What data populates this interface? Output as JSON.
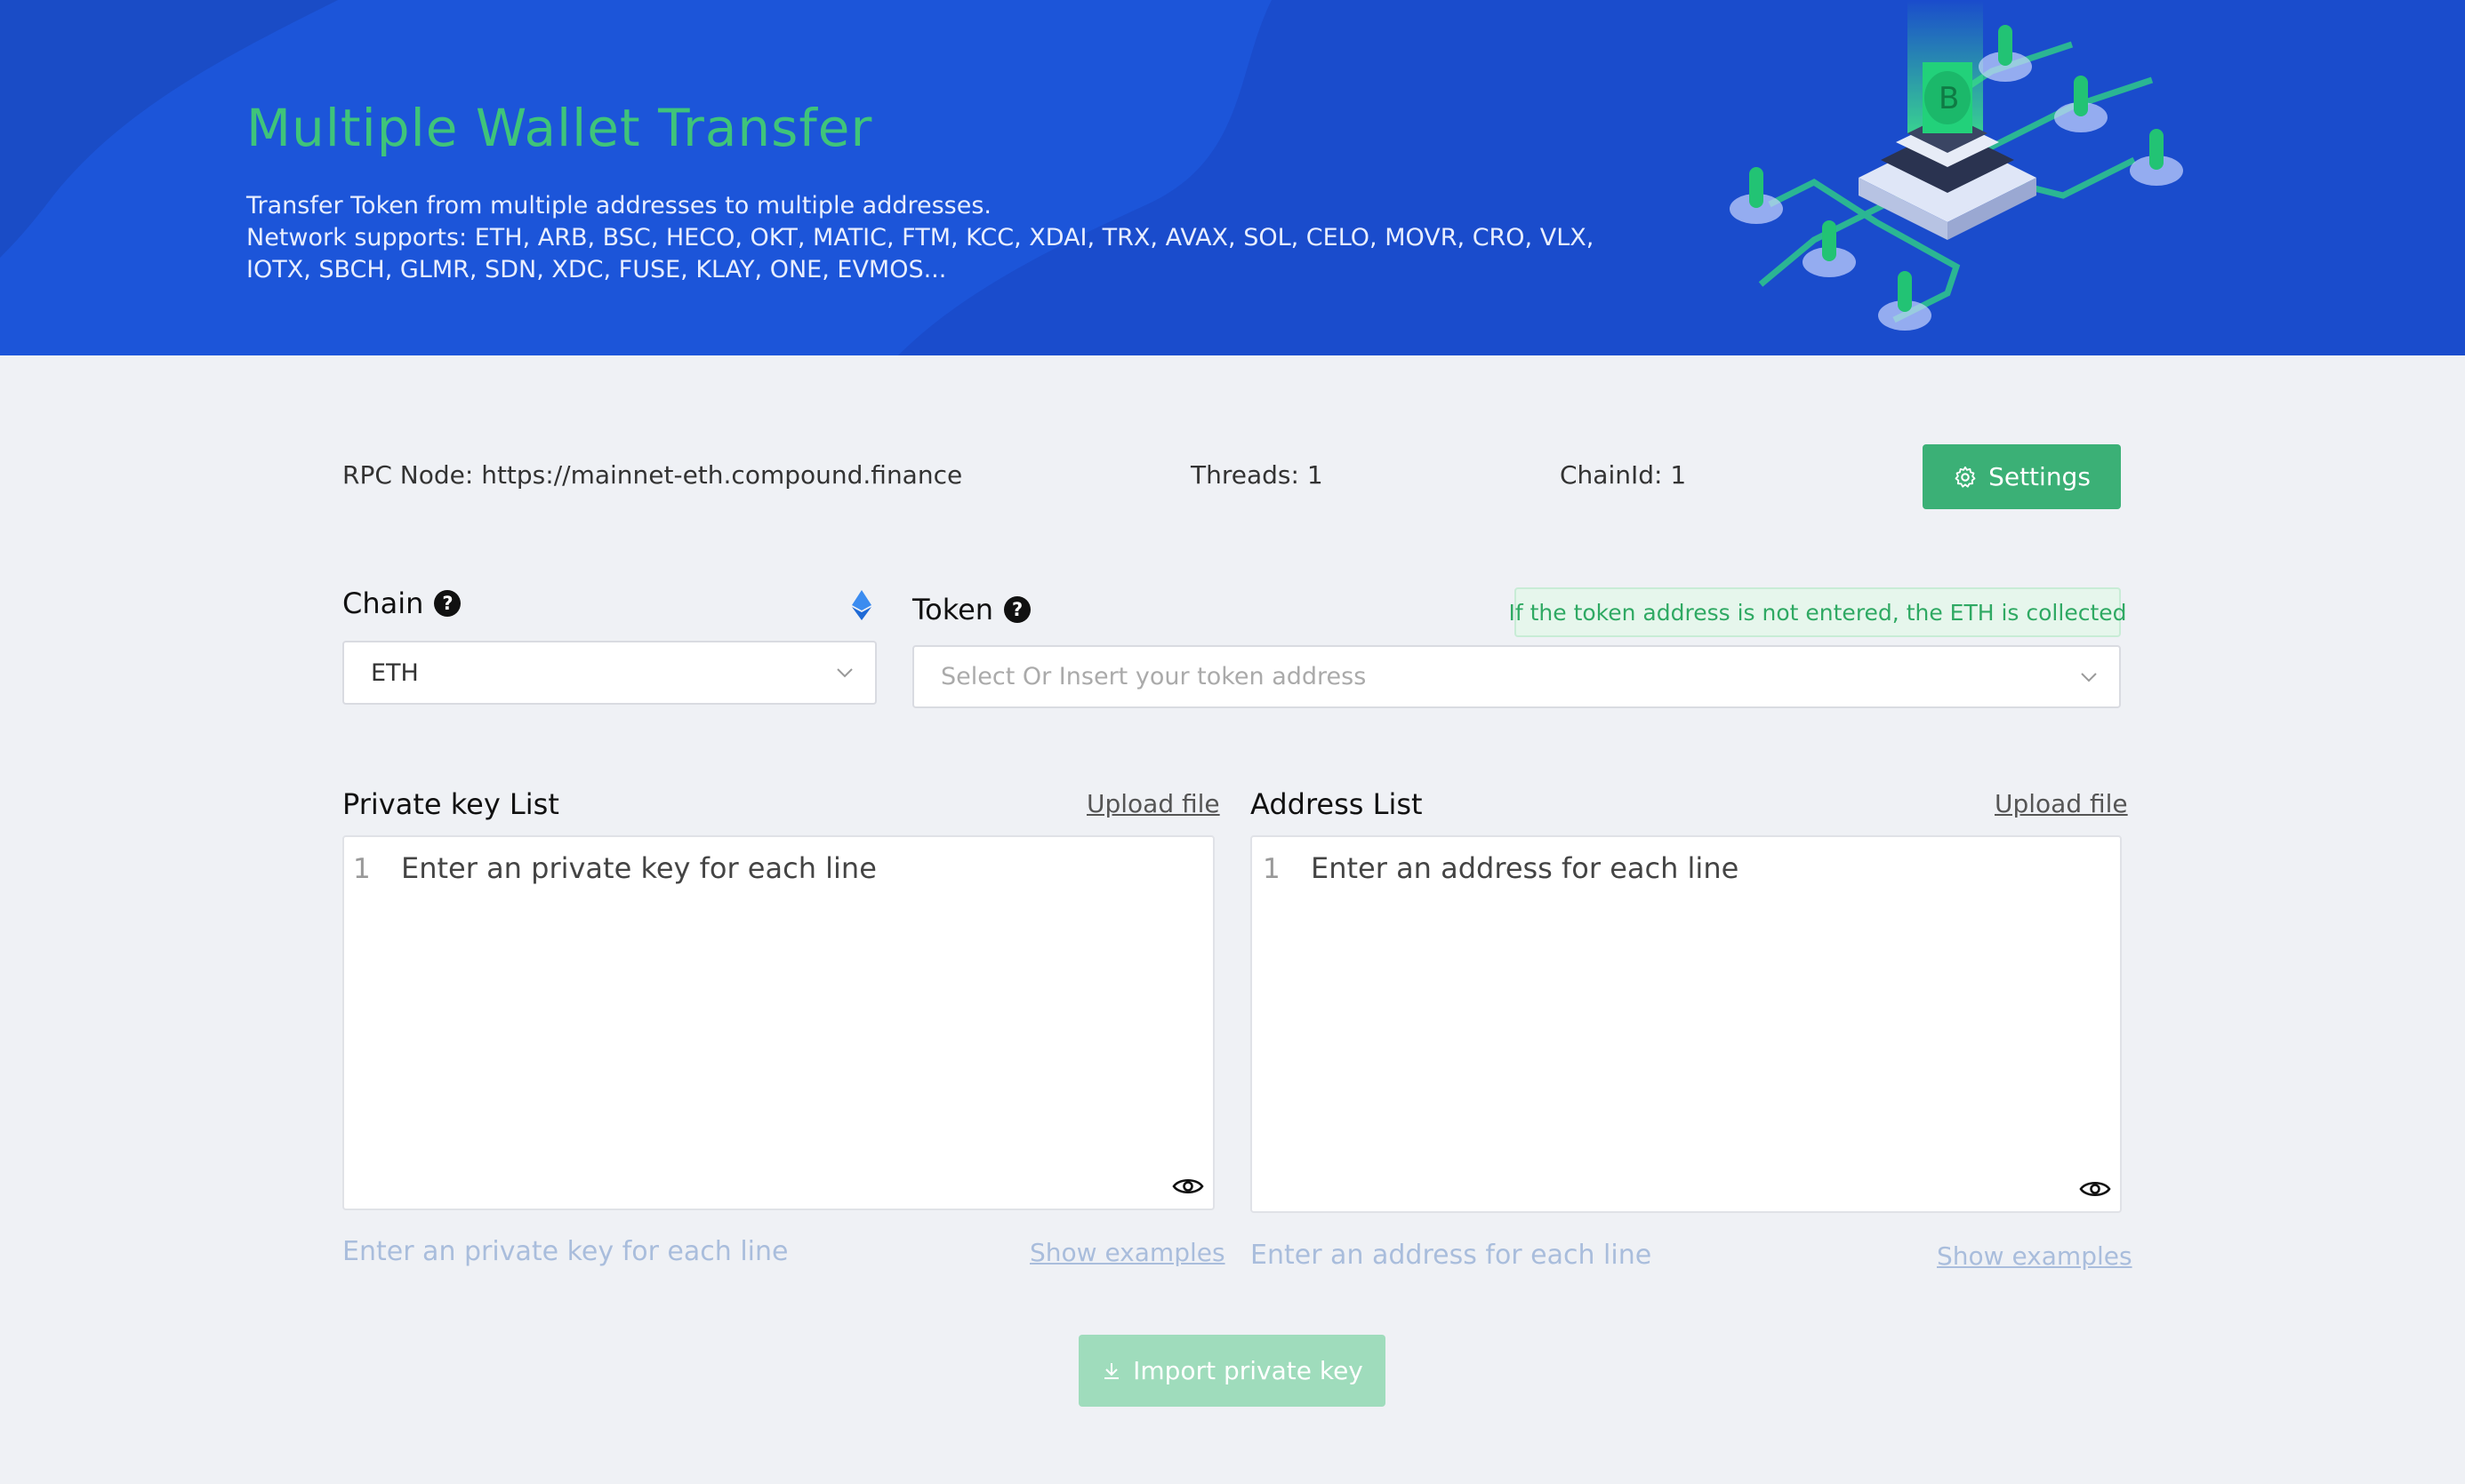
{
  "hero": {
    "title": "Multiple Wallet Transfer",
    "desc1": "Transfer Token from multiple addresses to multiple addresses.",
    "desc2": "Network supports:  ETH, ARB, BSC, HECO, OKT, MATIC, FTM, KCC, XDAI, TRX, AVAX, SOL, CELO, MOVR, CRO, VLX,",
    "desc3": "IOTX, SBCH, GLMR, SDN, XDC, FUSE, KLAY, ONE, EVMOS..."
  },
  "info": {
    "rpc": "RPC Node: https://mainnet-eth.compound.finance",
    "threads": "Threads: 1",
    "chainid": "ChainId: 1",
    "settings_label": "Settings"
  },
  "chain": {
    "label": "Chain",
    "value": "ETH",
    "icon": "ethereum-icon"
  },
  "token": {
    "label": "Token",
    "placeholder": "Select Or Insert your token address",
    "notice": "If the token address is not entered, the ETH is collected"
  },
  "private_keys": {
    "title": "Private key List",
    "upload": "Upload file",
    "line_number": "1",
    "placeholder": "Enter an private key for each line",
    "hint": "Enter an private key for each line",
    "examples": "Show examples"
  },
  "addresses": {
    "title": "Address List",
    "upload": "Upload file",
    "line_number": "1",
    "placeholder": "Enter an address for each line",
    "hint": "Enter an address for each line",
    "examples": "Show examples"
  },
  "import_label": "Import private key",
  "colors": {
    "banner": "#1c55d9",
    "accent": "#3bb076",
    "title_green": "#3fc47a"
  }
}
